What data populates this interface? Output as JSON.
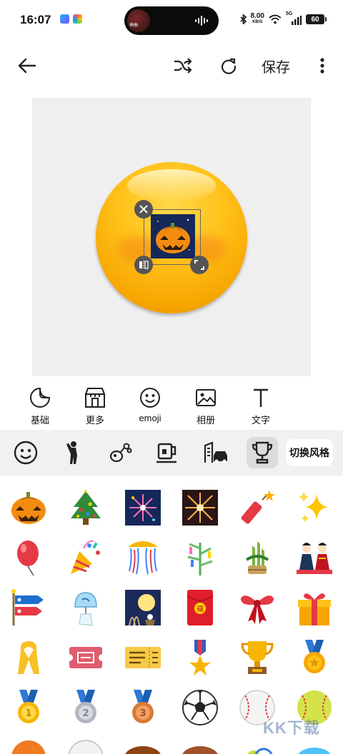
{
  "status_bar": {
    "time": "16:07",
    "island_label": "神曲",
    "net_speed_value": "8.00",
    "net_speed_unit": "KB/S",
    "network": "5G",
    "battery": "60"
  },
  "toolbar": {
    "back_icon": "arrow-left-icon",
    "shuffle_icon": "shuffle-icon",
    "refresh_icon": "refresh-icon",
    "save_label": "保存",
    "more_icon": "more-vertical-icon"
  },
  "canvas": {
    "base_emoji": "smiling-face",
    "sticker": "jack-o-lantern"
  },
  "categories": [
    {
      "icon": "sticker-icon",
      "label": "基础"
    },
    {
      "icon": "store-icon",
      "label": "更多"
    },
    {
      "icon": "smiley-icon",
      "label": "emoji"
    },
    {
      "icon": "image-icon",
      "label": "相册"
    },
    {
      "icon": "text-icon",
      "label": "文字"
    }
  ],
  "style_tabs": [
    "smiley-tab-icon",
    "person-tab-icon",
    "animal-tab-icon",
    "food-tab-icon",
    "travel-tab-icon",
    "trophy-tab-icon"
  ],
  "active_style_tab": "trophy-tab-icon",
  "switch_style_label": "切换风格",
  "emoji_grid": [
    [
      "jack-o-lantern",
      "christmas-tree",
      "fireworks",
      "sparkler",
      "firecracker",
      "sparkles"
    ],
    [
      "balloon",
      "party-popper",
      "confetti-ball",
      "tanabata-tree",
      "pine-decoration",
      "japanese-dolls"
    ],
    [
      "carp-streamer",
      "wind-chime",
      "moon-viewing",
      "red-envelope",
      "ribbon",
      "wrapped-gift"
    ],
    [
      "reminder-ribbon",
      "admission-tickets",
      "ticket",
      "military-medal",
      "trophy",
      "sports-medal"
    ],
    [
      "1st-place-medal",
      "2nd-place-medal",
      "3rd-place-medal",
      "soccer-ball",
      "baseball",
      "softball"
    ]
  ],
  "red_envelope_text": "福",
  "medal_numbers": [
    "1",
    "2",
    "3"
  ],
  "watermark": "KK下载"
}
